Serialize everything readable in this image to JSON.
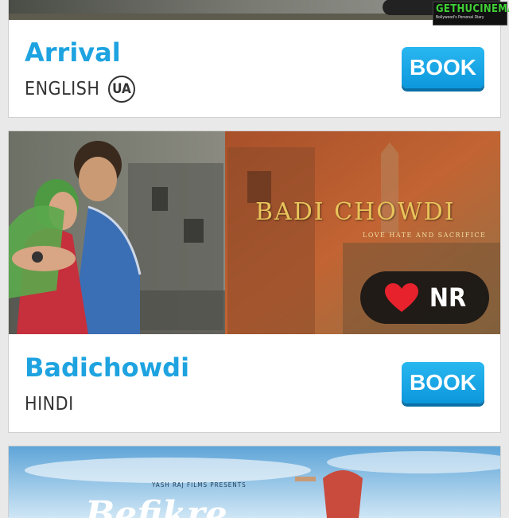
{
  "watermark": {
    "brand": "GETHUCINEMA",
    "tagline": "Bollywood's Personal Diary"
  },
  "movies": [
    {
      "title": "Arrival",
      "language": "ENGLISH",
      "certificate": "UA",
      "book_label": "BOOK"
    },
    {
      "title": "Badichowdi",
      "language": "HINDI",
      "poster_title": "BADI CHOWDI",
      "poster_tagline": "LOVE HATE AND SACRIFICE",
      "rating": "NR",
      "book_label": "BOOK"
    },
    {
      "poster_banner": "YASH RAJ FILMS PRESENTS",
      "poster_title": "Befikre"
    }
  ],
  "colors": {
    "accent": "#1ea3e0",
    "button": "#13a1e4",
    "heart": "#e8222d",
    "wm_green": "#3fcf35"
  },
  "icons": {
    "heart": "heart-icon"
  }
}
